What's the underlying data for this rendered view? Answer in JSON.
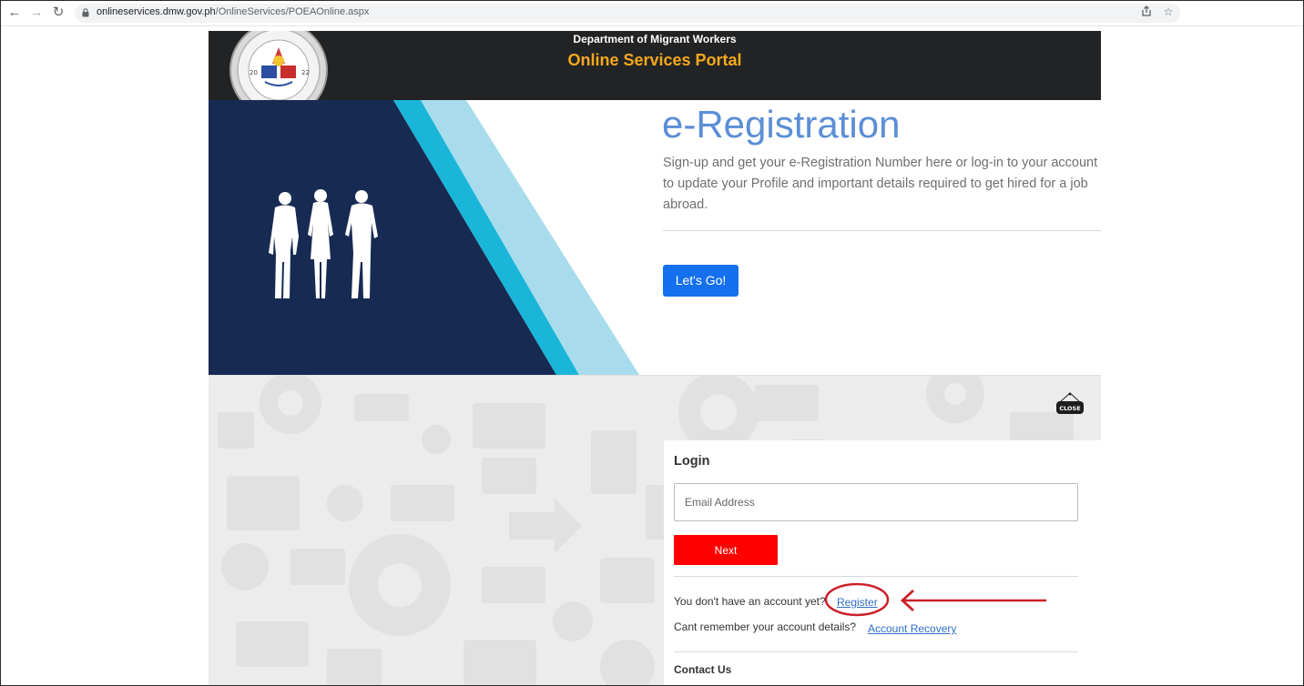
{
  "browser": {
    "url_host": "onlineservices.dmw.gov.ph",
    "url_path": "/OnlineServices/POEAOnline.aspx"
  },
  "header": {
    "department": "Department of Migrant Workers",
    "portal_title": "Online Services Portal",
    "seal_text": "DEPARTMENT OF MIGRANT WORKERS",
    "seal_year_left": "20",
    "seal_year_right": "22",
    "seal_motto": "REPUBLIKA NG PILIPINAS"
  },
  "hero": {
    "title": "e-Registration",
    "description": "Sign-up and get your e-Registration Number here or log-in to your account to update your Profile and important details required to get hired for a job abroad.",
    "cta_label": "Let's Go!"
  },
  "login": {
    "heading": "Login",
    "email_placeholder": "Email Address",
    "next_label": "Next",
    "no_account_text": "You don't have an account yet?",
    "register_link": "Register",
    "cant_remember_text": "Cant remember your account details?",
    "recovery_link": "Account Recovery",
    "contact_heading": "Contact Us",
    "close_label": "CLOSE"
  },
  "colors": {
    "header_bg": "#222324",
    "portal_title": "#f5a81e",
    "hero_navy": "#172a52",
    "hero_cyan": "#1ab6d9",
    "hero_light_cyan": "#a8dcec",
    "hero_title": "#5b8ed6",
    "cta_blue": "#1570ef",
    "next_red": "#ff0000",
    "link_blue": "#2f6fc7",
    "annotation_red": "#cc1f2a"
  }
}
